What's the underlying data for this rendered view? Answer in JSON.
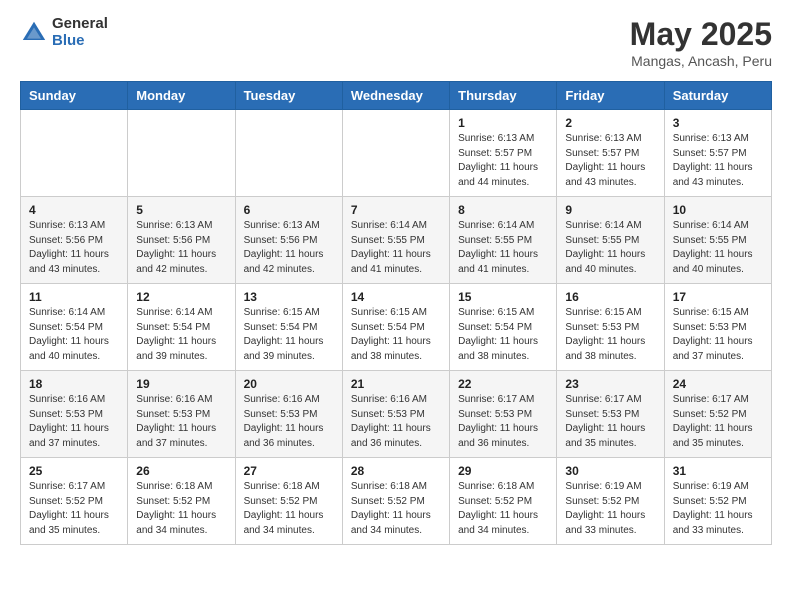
{
  "logo": {
    "general": "General",
    "blue": "Blue"
  },
  "title": {
    "month": "May 2025",
    "location": "Mangas, Ancash, Peru"
  },
  "headers": [
    "Sunday",
    "Monday",
    "Tuesday",
    "Wednesday",
    "Thursday",
    "Friday",
    "Saturday"
  ],
  "weeks": [
    [
      {
        "day": "",
        "info": ""
      },
      {
        "day": "",
        "info": ""
      },
      {
        "day": "",
        "info": ""
      },
      {
        "day": "",
        "info": ""
      },
      {
        "day": "1",
        "info": "Sunrise: 6:13 AM\nSunset: 5:57 PM\nDaylight: 11 hours and 44 minutes."
      },
      {
        "day": "2",
        "info": "Sunrise: 6:13 AM\nSunset: 5:57 PM\nDaylight: 11 hours and 43 minutes."
      },
      {
        "day": "3",
        "info": "Sunrise: 6:13 AM\nSunset: 5:57 PM\nDaylight: 11 hours and 43 minutes."
      }
    ],
    [
      {
        "day": "4",
        "info": "Sunrise: 6:13 AM\nSunset: 5:56 PM\nDaylight: 11 hours and 43 minutes."
      },
      {
        "day": "5",
        "info": "Sunrise: 6:13 AM\nSunset: 5:56 PM\nDaylight: 11 hours and 42 minutes."
      },
      {
        "day": "6",
        "info": "Sunrise: 6:13 AM\nSunset: 5:56 PM\nDaylight: 11 hours and 42 minutes."
      },
      {
        "day": "7",
        "info": "Sunrise: 6:14 AM\nSunset: 5:55 PM\nDaylight: 11 hours and 41 minutes."
      },
      {
        "day": "8",
        "info": "Sunrise: 6:14 AM\nSunset: 5:55 PM\nDaylight: 11 hours and 41 minutes."
      },
      {
        "day": "9",
        "info": "Sunrise: 6:14 AM\nSunset: 5:55 PM\nDaylight: 11 hours and 40 minutes."
      },
      {
        "day": "10",
        "info": "Sunrise: 6:14 AM\nSunset: 5:55 PM\nDaylight: 11 hours and 40 minutes."
      }
    ],
    [
      {
        "day": "11",
        "info": "Sunrise: 6:14 AM\nSunset: 5:54 PM\nDaylight: 11 hours and 40 minutes."
      },
      {
        "day": "12",
        "info": "Sunrise: 6:14 AM\nSunset: 5:54 PM\nDaylight: 11 hours and 39 minutes."
      },
      {
        "day": "13",
        "info": "Sunrise: 6:15 AM\nSunset: 5:54 PM\nDaylight: 11 hours and 39 minutes."
      },
      {
        "day": "14",
        "info": "Sunrise: 6:15 AM\nSunset: 5:54 PM\nDaylight: 11 hours and 38 minutes."
      },
      {
        "day": "15",
        "info": "Sunrise: 6:15 AM\nSunset: 5:54 PM\nDaylight: 11 hours and 38 minutes."
      },
      {
        "day": "16",
        "info": "Sunrise: 6:15 AM\nSunset: 5:53 PM\nDaylight: 11 hours and 38 minutes."
      },
      {
        "day": "17",
        "info": "Sunrise: 6:15 AM\nSunset: 5:53 PM\nDaylight: 11 hours and 37 minutes."
      }
    ],
    [
      {
        "day": "18",
        "info": "Sunrise: 6:16 AM\nSunset: 5:53 PM\nDaylight: 11 hours and 37 minutes."
      },
      {
        "day": "19",
        "info": "Sunrise: 6:16 AM\nSunset: 5:53 PM\nDaylight: 11 hours and 37 minutes."
      },
      {
        "day": "20",
        "info": "Sunrise: 6:16 AM\nSunset: 5:53 PM\nDaylight: 11 hours and 36 minutes."
      },
      {
        "day": "21",
        "info": "Sunrise: 6:16 AM\nSunset: 5:53 PM\nDaylight: 11 hours and 36 minutes."
      },
      {
        "day": "22",
        "info": "Sunrise: 6:17 AM\nSunset: 5:53 PM\nDaylight: 11 hours and 36 minutes."
      },
      {
        "day": "23",
        "info": "Sunrise: 6:17 AM\nSunset: 5:53 PM\nDaylight: 11 hours and 35 minutes."
      },
      {
        "day": "24",
        "info": "Sunrise: 6:17 AM\nSunset: 5:52 PM\nDaylight: 11 hours and 35 minutes."
      }
    ],
    [
      {
        "day": "25",
        "info": "Sunrise: 6:17 AM\nSunset: 5:52 PM\nDaylight: 11 hours and 35 minutes."
      },
      {
        "day": "26",
        "info": "Sunrise: 6:18 AM\nSunset: 5:52 PM\nDaylight: 11 hours and 34 minutes."
      },
      {
        "day": "27",
        "info": "Sunrise: 6:18 AM\nSunset: 5:52 PM\nDaylight: 11 hours and 34 minutes."
      },
      {
        "day": "28",
        "info": "Sunrise: 6:18 AM\nSunset: 5:52 PM\nDaylight: 11 hours and 34 minutes."
      },
      {
        "day": "29",
        "info": "Sunrise: 6:18 AM\nSunset: 5:52 PM\nDaylight: 11 hours and 34 minutes."
      },
      {
        "day": "30",
        "info": "Sunrise: 6:19 AM\nSunset: 5:52 PM\nDaylight: 11 hours and 33 minutes."
      },
      {
        "day": "31",
        "info": "Sunrise: 6:19 AM\nSunset: 5:52 PM\nDaylight: 11 hours and 33 minutes."
      }
    ]
  ]
}
